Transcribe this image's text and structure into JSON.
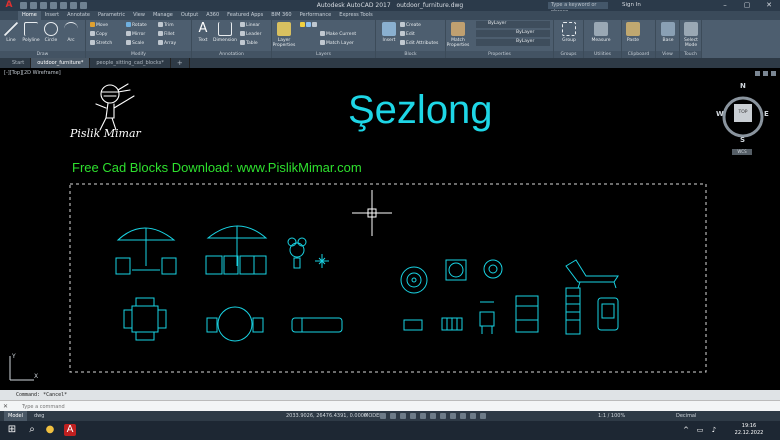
{
  "titlebar": {
    "app_title": "Autodesk AutoCAD 2017",
    "file_name": "outdoor_furniture.dwg",
    "search_placeholder": "Type a keyword or phrase",
    "sign_in": "Sign In"
  },
  "ribbon_tabs": [
    "Home",
    "Insert",
    "Annotate",
    "Parametric",
    "View",
    "Manage",
    "Output",
    "A360",
    "Featured Apps",
    "BIM 360",
    "Performance",
    "Express Tools"
  ],
  "ribbon": {
    "draw": {
      "label": "Draw",
      "line": "Line",
      "polyline": "Polyline",
      "circle": "Circle",
      "arc": "Arc"
    },
    "modify": {
      "label": "Modify",
      "move": "Move",
      "rotate": "Rotate",
      "trim": "Trim",
      "copy": "Copy",
      "mirror": "Mirror",
      "fillet": "Fillet",
      "stretch": "Stretch",
      "scale": "Scale",
      "array": "Array"
    },
    "annotation": {
      "label": "Annotation",
      "text": "Text",
      "dimension": "Dimension",
      "linear": "Linear",
      "leader": "Leader",
      "table": "Table"
    },
    "layers": {
      "label": "Layers",
      "layer_properties": "Layer Properties",
      "make_current": "Make Current",
      "match_layer": "Match Layer"
    },
    "block": {
      "label": "Block",
      "insert": "Insert",
      "create": "Create",
      "edit": "Edit",
      "edit_attributes": "Edit Attributes"
    },
    "properties": {
      "label": "Properties",
      "match_properties": "Match Properties",
      "bylayer": "ByLayer"
    },
    "groups": {
      "label": "Groups",
      "group": "Group"
    },
    "utilities": {
      "label": "Utilities",
      "measure": "Measure"
    },
    "clipboard": {
      "label": "Clipboard",
      "paste": "Paste"
    },
    "view": {
      "label": "View",
      "base": "Base"
    },
    "touch": {
      "label": "Touch",
      "select_mode": "Select Mode"
    }
  },
  "doc_tabs": [
    "Start",
    "outdoor_furniture*",
    "people_sitting_cad_blocks*"
  ],
  "viewport": {
    "controls": "[-][Top][2D Wireframe]",
    "drawing_title": "Şezlong",
    "site_text": "Free Cad Blocks Download: www.PislikMimar.com",
    "logo_text": "Pislik Mimar"
  },
  "viewcube": {
    "n": "N",
    "s": "S",
    "e": "E",
    "w": "W",
    "face": "TOP",
    "wcs": "WCS"
  },
  "command": {
    "history": "Command: *Cancel*",
    "placeholder": "Type a command"
  },
  "statusbar": {
    "tabs": [
      "Model",
      "dwg"
    ],
    "coords": "2033.9026, 26476.4391, 0.0000",
    "mode": "MODEL",
    "scale": "1:1 / 100%",
    "units": "Decimal"
  },
  "taskbar": {
    "time": "19:16",
    "date": "22.12.2022"
  },
  "colors": {
    "title_cyan": "#1ed6e6",
    "site_green": "#2ee02e",
    "blocks_cyan": "#19d3e3",
    "ribbon": "#4d5e6f"
  }
}
